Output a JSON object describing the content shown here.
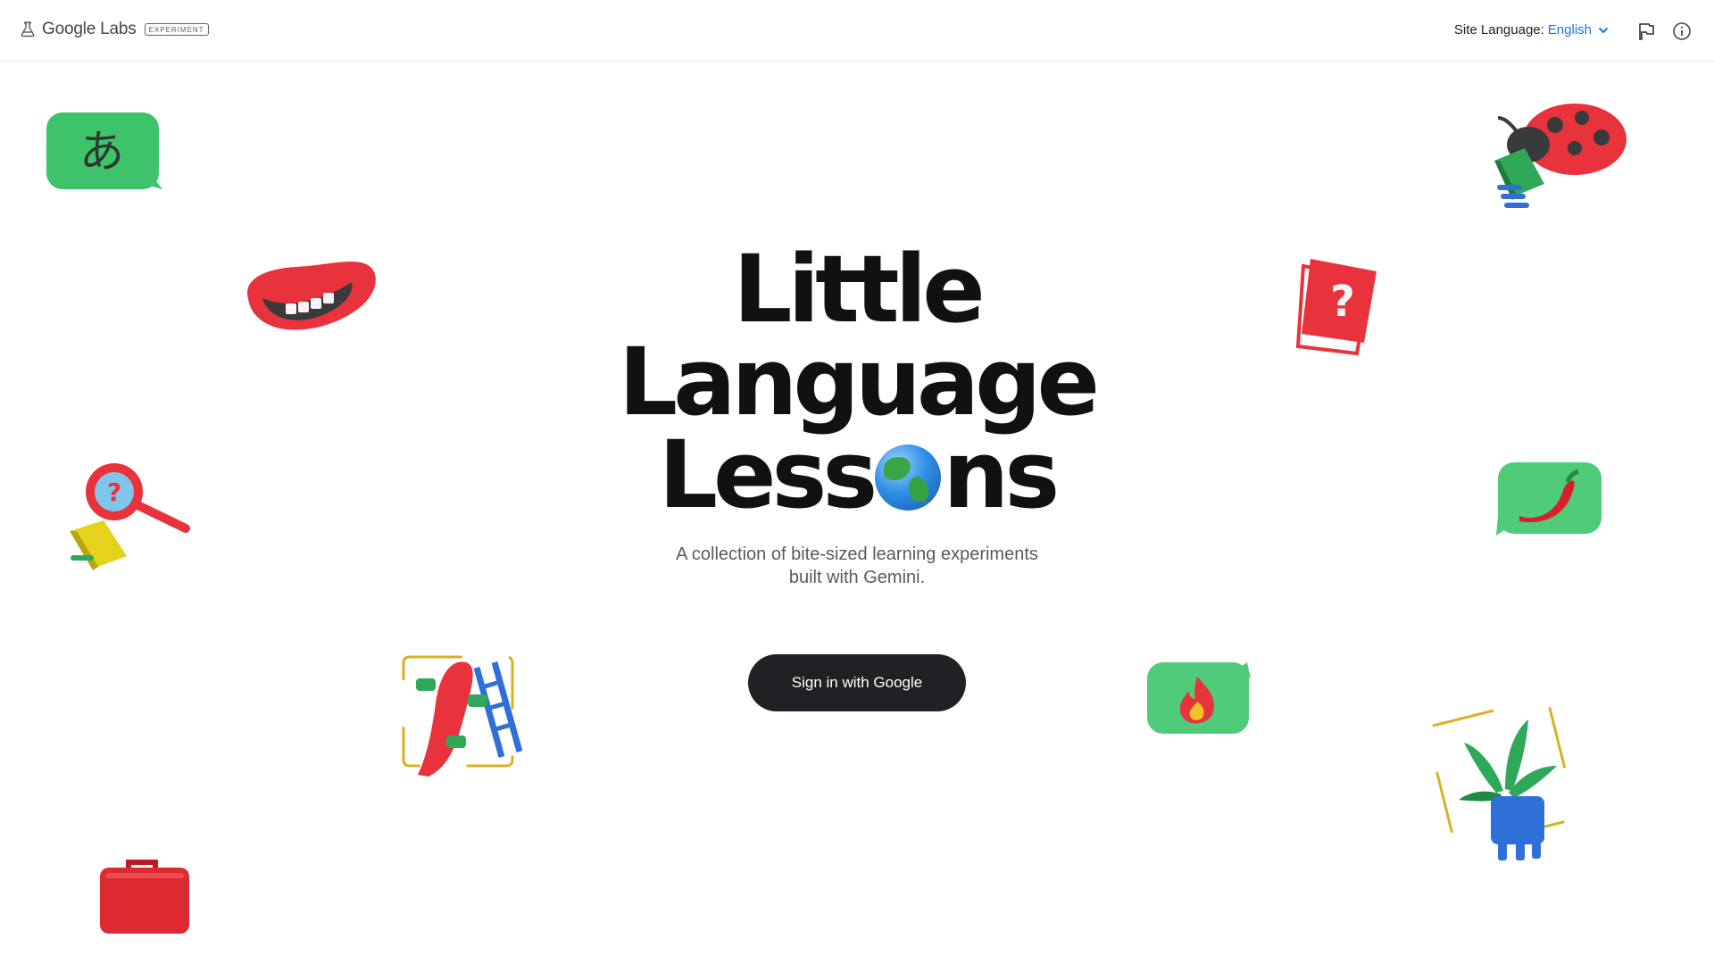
{
  "header": {
    "brand_name": "Google Labs",
    "brand_badge": "EXPERIMENT",
    "site_language_label": "Site Language:",
    "site_language_value": "English",
    "icons": [
      "flask-icon",
      "chevron-down-icon",
      "flag-icon",
      "info-icon"
    ]
  },
  "hero": {
    "title_line1": "Little",
    "title_line2": "Language",
    "title_line3_part1": "Less",
    "title_line3_part2": "ns",
    "subtitle_line1": "A collection of bite-sized learning experiments",
    "subtitle_line2": "built with Gemini.",
    "signin_label": "Sign in with Google"
  },
  "decorations": [
    "hiragana-a-bubble",
    "smiling-mouth",
    "magnifier-book",
    "slide-ladder",
    "lunchbox",
    "ladybug-book",
    "question-sign",
    "chili-bubble",
    "flame-bubble",
    "potted-plant"
  ],
  "colors": {
    "accent_link": "#1a73e8",
    "button_bg": "#1f2124",
    "title": "#111111"
  }
}
